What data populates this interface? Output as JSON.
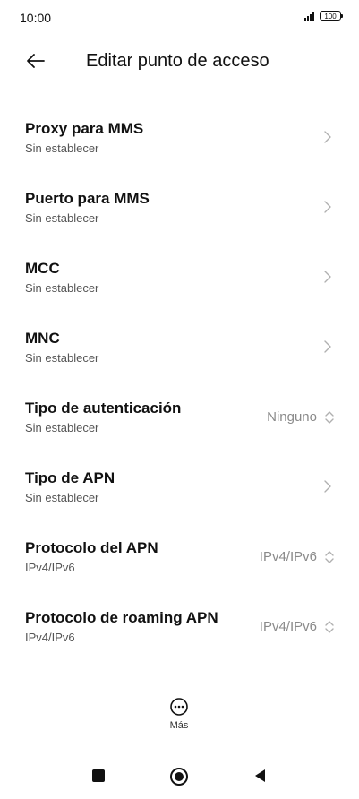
{
  "status_bar": {
    "time": "10:00",
    "battery": "100"
  },
  "header": {
    "title": "Editar punto de acceso"
  },
  "items": [
    {
      "title": "Proxy para MMS",
      "subtitle": "Sin establecer",
      "value": "",
      "control": "chevron"
    },
    {
      "title": "Puerto para MMS",
      "subtitle": "Sin establecer",
      "value": "",
      "control": "chevron"
    },
    {
      "title": "MCC",
      "subtitle": "Sin establecer",
      "value": "",
      "control": "chevron"
    },
    {
      "title": "MNC",
      "subtitle": "Sin establecer",
      "value": "",
      "control": "chevron"
    },
    {
      "title": "Tipo de autenticación",
      "subtitle": "Sin establecer",
      "value": "Ninguno",
      "control": "updown"
    },
    {
      "title": "Tipo de APN",
      "subtitle": "Sin establecer",
      "value": "",
      "control": "chevron"
    },
    {
      "title": "Protocolo del APN",
      "subtitle": "IPv4/IPv6",
      "value": "IPv4/IPv6",
      "control": "updown"
    },
    {
      "title": "Protocolo de roaming APN",
      "subtitle": "IPv4/IPv6",
      "value": "IPv4/IPv6",
      "control": "updown"
    }
  ],
  "bottom": {
    "more_label": "Más"
  },
  "colors": {
    "text_primary": "#111111",
    "text_secondary": "#555555",
    "value_gray": "#8a8a8a",
    "icon_gray": "#b0b0b0"
  },
  "icons": {
    "back": "arrow-left-icon",
    "chevron": "chevron-right-icon",
    "updown": "up-down-arrows-icon",
    "more": "more-dots-icon",
    "nav_recents": "square-icon",
    "nav_home": "circle-icon",
    "nav_back": "triangle-back-icon"
  }
}
